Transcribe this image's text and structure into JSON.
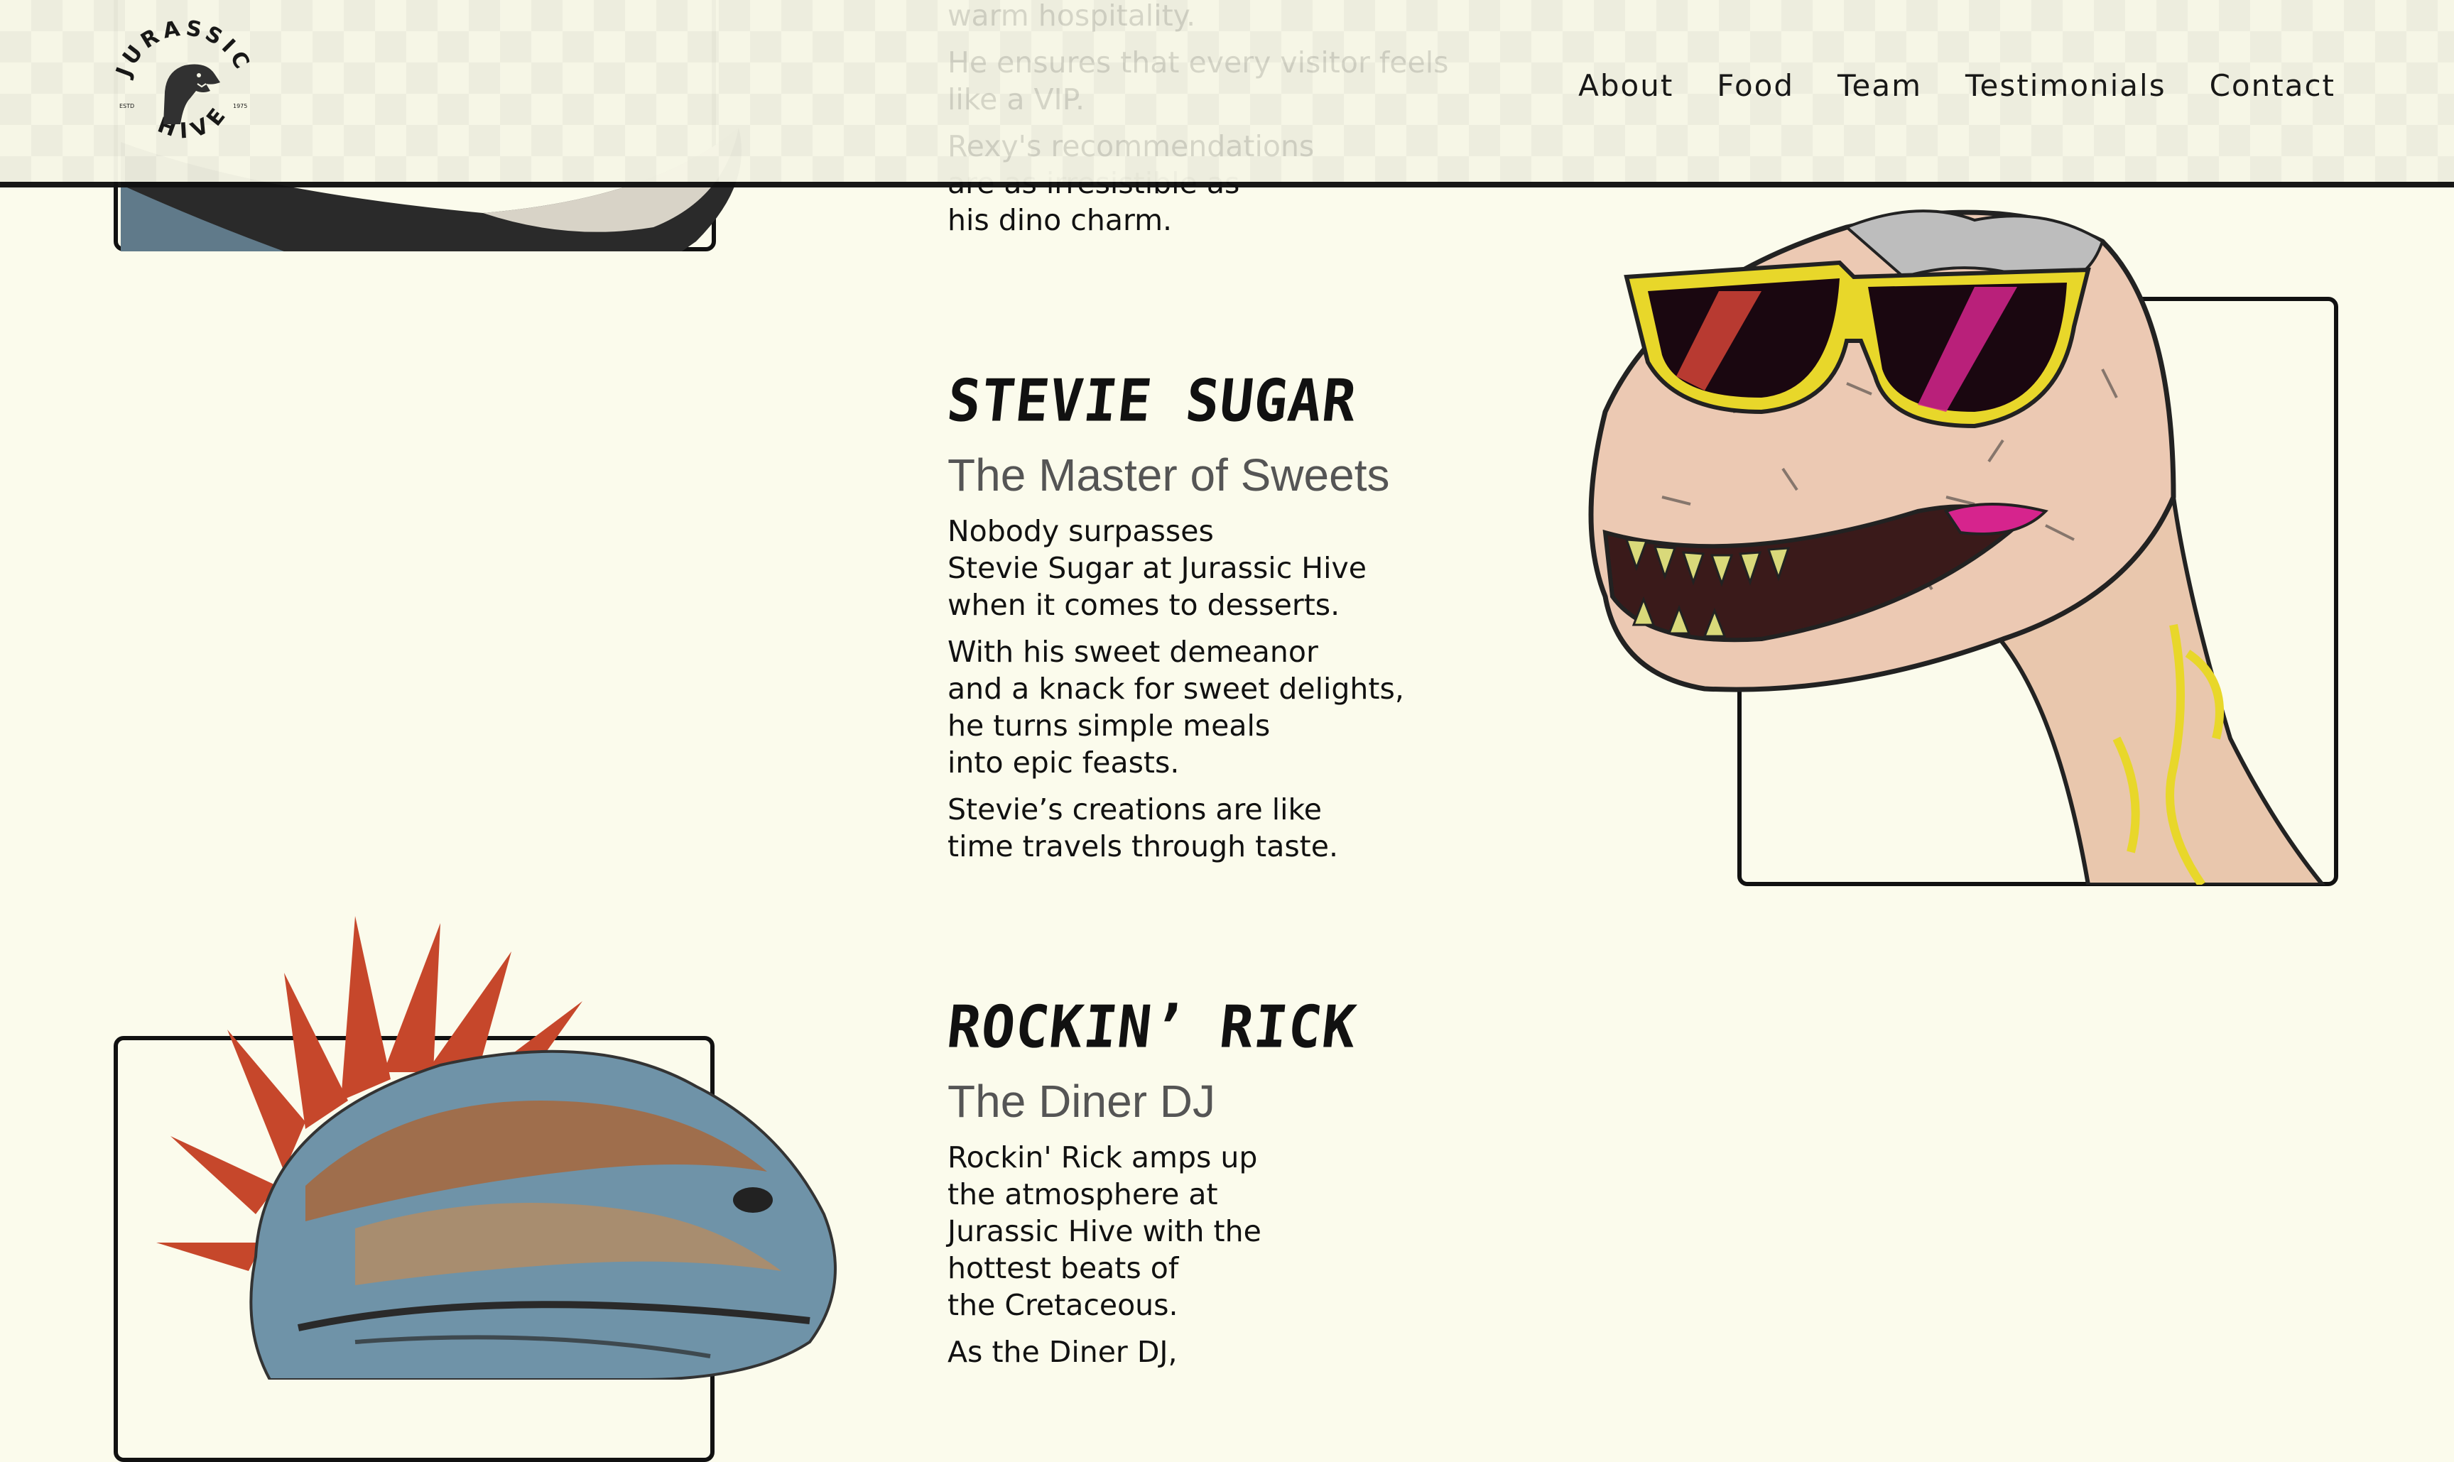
{
  "brand": {
    "logo_text_top": "JURASSIC",
    "logo_text_bottom": "HIVE",
    "logo_left": "ESTD",
    "logo_right": "1975"
  },
  "nav": {
    "items": [
      "About",
      "Food",
      "Team",
      "Testimonials",
      "Contact"
    ]
  },
  "rexy": {
    "ghost_lines": [
      "warm hospitality.",
      "He ensures that every visitor feels like a VIP.",
      "Rexy's recommendations"
    ],
    "visible_lines": [
      "are as irresistible as",
      "his dino charm."
    ]
  },
  "stevie": {
    "name": "STEVIE SUGAR",
    "role": "The Master of Sweets",
    "paragraphs": [
      "Nobody surpasses\nStevie Sugar at Jurassic Hive\nwhen it comes to desserts.",
      "With his sweet demeanor\nand a knack for sweet delights,\nhe turns simple meals\ninto epic feasts.",
      "Stevie’s creations are like\ntime travels through taste."
    ]
  },
  "rick": {
    "name": "ROCKIN’ RICK",
    "role": "The Diner DJ",
    "paragraphs": [
      "Rockin' Rick amps up\nthe atmosphere at\nJurassic Hive with the\nhottest beats of\nthe Cretaceous.",
      "As the Diner DJ,"
    ]
  },
  "colors": {
    "background": "#fbfbec",
    "ink": "#111111",
    "accent_yellow": "#e8d72a",
    "accent_magenta": "#d6248d",
    "mohawk_red": "#c6472b"
  }
}
